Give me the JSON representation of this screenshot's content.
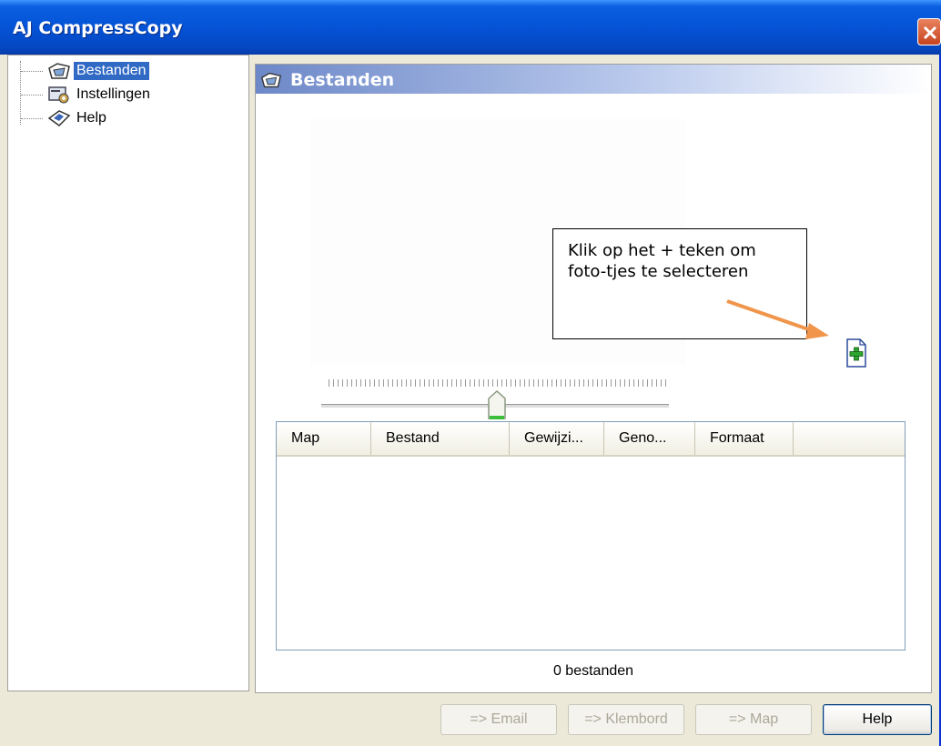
{
  "window": {
    "title": "AJ CompressCopy"
  },
  "tree": {
    "items": [
      {
        "label": "Bestanden",
        "icon": "folder-pictures-icon",
        "selected": true
      },
      {
        "label": "Instellingen",
        "icon": "settings-icon",
        "selected": false
      },
      {
        "label": "Help",
        "icon": "help-book-icon",
        "selected": false
      }
    ]
  },
  "panel": {
    "title": "Bestanden"
  },
  "callout": {
    "text": "Klik op het + teken om foto-tjes te selecteren"
  },
  "listview": {
    "columns": [
      "Map",
      "Bestand",
      "Gewijzi...",
      "Geno...",
      "Formaat"
    ]
  },
  "status": {
    "count_text": "0 bestanden"
  },
  "buttons": {
    "email": "=> Email",
    "klembord": "=> Klembord",
    "map": "=> Map",
    "help": "Help"
  },
  "colors": {
    "titlebar": "#0553d6",
    "selection": "#316ac5",
    "arrow": "#f0954a"
  }
}
